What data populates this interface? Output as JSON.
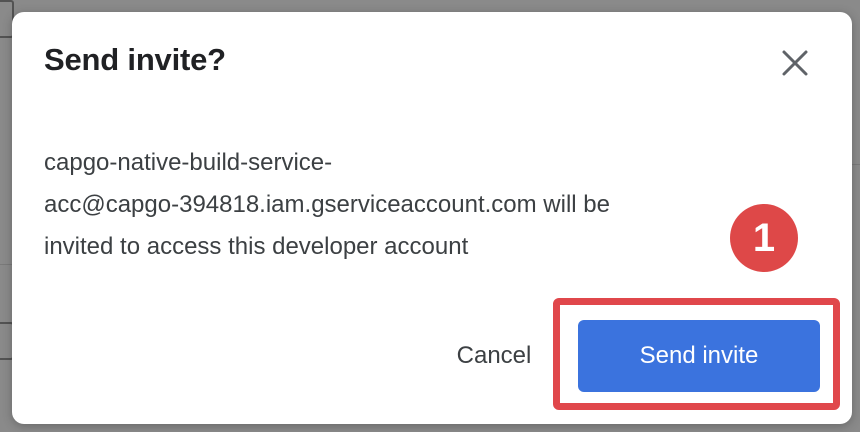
{
  "dialog": {
    "title": "Send invite?",
    "close_icon": "close-icon",
    "message_lines": [
      "capgo-native-build-service-",
      "acc@capgo-394818.iam.gserviceaccount.com will be",
      "invited to access this developer account"
    ],
    "cancel_label": "Cancel",
    "send_label": "Send invite"
  },
  "annotation": {
    "step_number": "1",
    "highlight_color": "#e0474b"
  },
  "colors": {
    "primary_button": "#3b73de",
    "step_badge": "#de4848"
  }
}
